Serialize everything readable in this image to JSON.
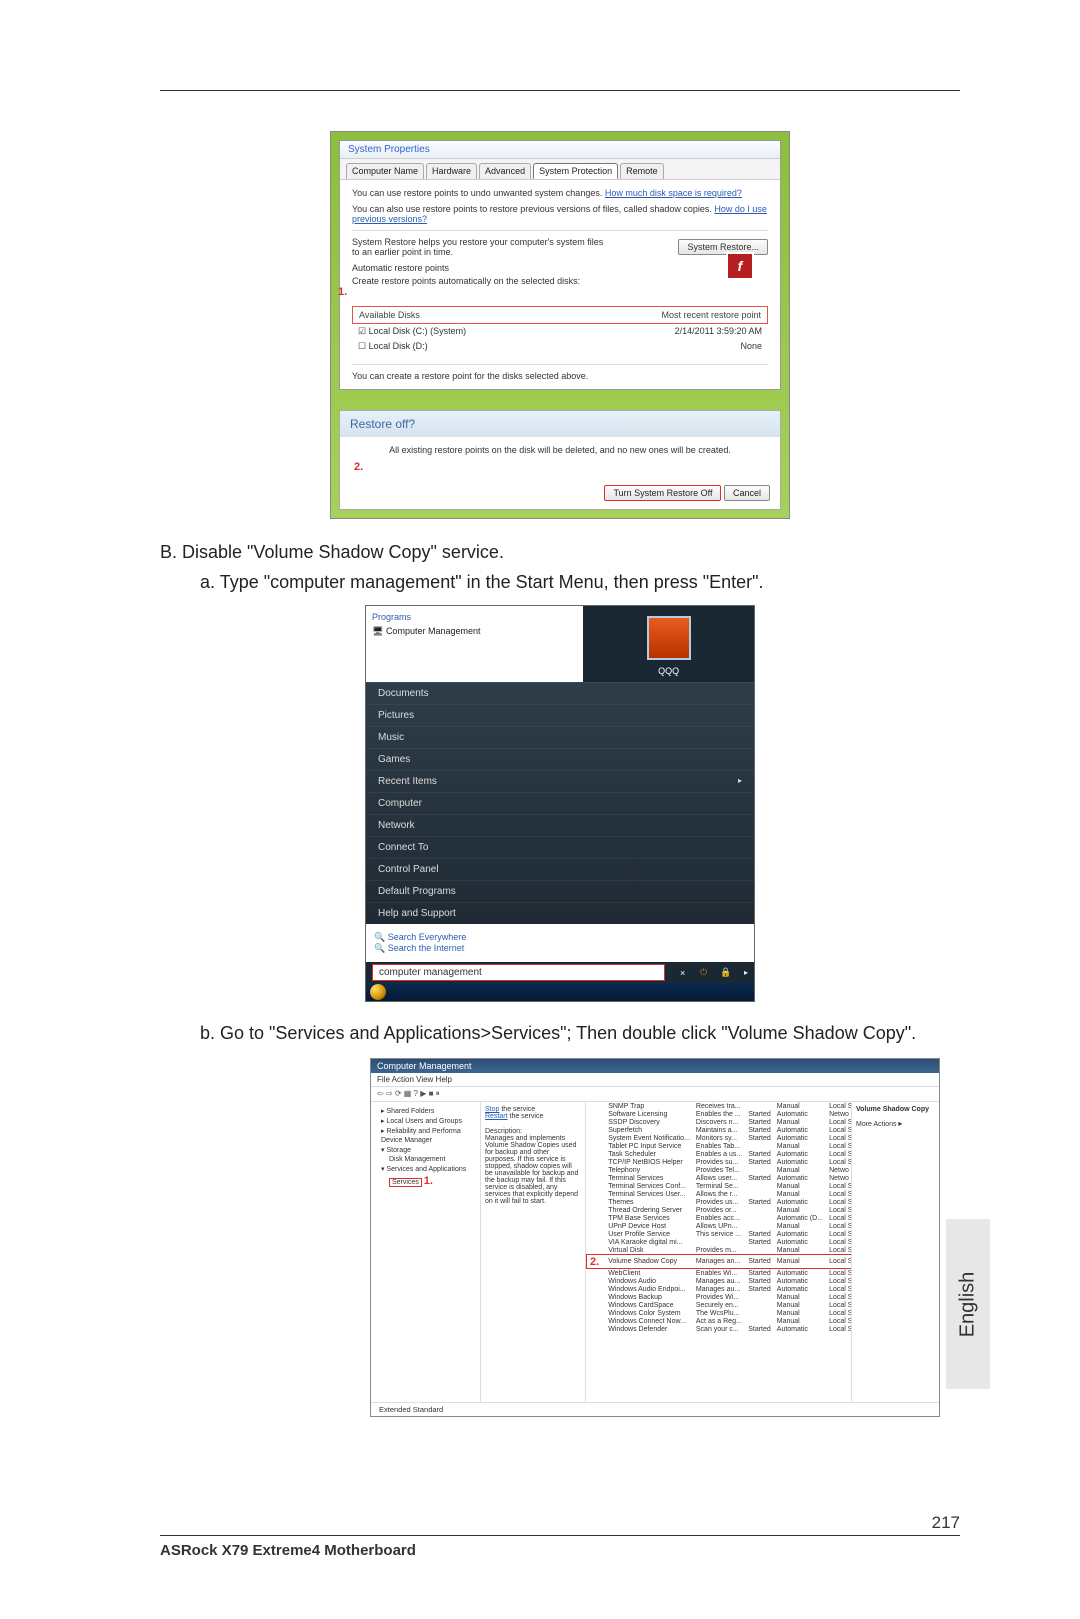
{
  "page": {
    "number": "217",
    "footer": "ASRock  X79  Extreme4  Motherboard",
    "language_tab": "English"
  },
  "instructions": {
    "b_heading": "B. Disable \"Volume Shadow Copy\" service.",
    "b_a": "a. Type \"computer management\" in the Start Menu, then press \"Enter\".",
    "b_b": "b. Go to \"Services and Applications>Services\"; Then double click \"Volume Shadow Copy\"."
  },
  "sys_props": {
    "title": "System Properties",
    "tabs": [
      "Computer Name",
      "Hardware",
      "Advanced",
      "System Protection",
      "Remote"
    ],
    "active_tab": 3,
    "line1a": "You can use restore points to undo unwanted system changes. ",
    "line1_link": "How much disk space is required?",
    "line2a": "You can also use restore points to restore previous versions of files, called shadow copies. ",
    "line2_link": "How do I use previous versions?",
    "restore_text": "System Restore helps you restore your computer's system files to an earlier point in time.",
    "restore_btn": "System Restore...",
    "auto_heading": "Automatic restore points",
    "auto_sub": "Create restore points automatically on the selected disks:",
    "col_disks": "Available Disks",
    "col_recent": "Most recent restore point",
    "disk1_name": "Local Disk (C:) (System)",
    "disk1_date": "2/14/2011 3:59:20 AM",
    "disk2_name": "Local Disk (D:)",
    "disk2_date": "None",
    "create_text": "You can create a restore point for the disks selected above.",
    "callout1": "1.",
    "desktop_icon": "install_flash..."
  },
  "confirm": {
    "title": "Restore off?",
    "body": "All existing restore points on the disk will be deleted, and no new ones will be created.",
    "callout2": "2.",
    "btn_primary": "Turn System Restore Off",
    "btn_cancel": "Cancel"
  },
  "start_menu": {
    "programs_hdr": "Programs",
    "program_item": "Computer Management",
    "user": "QQQ",
    "items": [
      "Documents",
      "Pictures",
      "Music",
      "Games",
      "Recent Items",
      "Computer",
      "Network",
      "Connect To",
      "Control Panel",
      "Default Programs",
      "Help and Support"
    ],
    "search_everywhere": "Search Everywhere",
    "search_internet": "Search the Internet",
    "search_value": "computer management",
    "close_x": "×"
  },
  "comp_mgmt": {
    "title": "Computer Management",
    "menus": "File   Action   View   Help",
    "tree": {
      "shared": "Shared Folders",
      "users": "Local Users and Groups",
      "reliability": "Reliability and Performa",
      "devmgr": "Device Manager",
      "storage": "Storage",
      "diskmgmt": "Disk Management",
      "svc_apps": "Services and Applications",
      "services": "Services",
      "callout1": "1."
    },
    "mid": {
      "stop": "Stop",
      "the_service": " the service",
      "restart": "Restart",
      "desc_hdr": "Description:",
      "desc": "Manages and implements Volume Shadow Copies used for backup and other purposes. If this service is stopped, shadow copies will be unavailable for backup and the backup may fail. If this service is disabled, any services that explicitly depend on it will fail to start."
    },
    "actions": {
      "hdr": "Volume Shadow Copy",
      "more": "More Actions"
    },
    "callout2": "2.",
    "footer_tabs": "Extended   Standard",
    "services": [
      [
        "SNMP Trap",
        "Receives tra...",
        "",
        "Manual",
        "Local S"
      ],
      [
        "Software Licensing",
        "Enables the ...",
        "Started",
        "Automatic",
        "Netwo"
      ],
      [
        "SSDP Discovery",
        "Discovers n...",
        "Started",
        "Manual",
        "Local S"
      ],
      [
        "Superfetch",
        "Maintains a...",
        "Started",
        "Automatic",
        "Local S"
      ],
      [
        "System Event Notificatio...",
        "Monitors sy...",
        "Started",
        "Automatic",
        "Local S"
      ],
      [
        "Tablet PC Input Service",
        "Enables Tab...",
        "",
        "Manual",
        "Local S"
      ],
      [
        "Task Scheduler",
        "Enables a us...",
        "Started",
        "Automatic",
        "Local S"
      ],
      [
        "TCP/IP NetBIOS Helper",
        "Provides su...",
        "Started",
        "Automatic",
        "Local S"
      ],
      [
        "Telephony",
        "Provides Tel...",
        "",
        "Manual",
        "Netwo"
      ],
      [
        "Terminal Services",
        "Allows user...",
        "Started",
        "Automatic",
        "Netwo"
      ],
      [
        "Terminal Services Conf...",
        "Terminal Se...",
        "",
        "Manual",
        "Local S"
      ],
      [
        "Terminal Services User...",
        "Allows the r...",
        "",
        "Manual",
        "Local S"
      ],
      [
        "Themes",
        "Provides us...",
        "Started",
        "Automatic",
        "Local S"
      ],
      [
        "Thread Ordering Server",
        "Provides or...",
        "",
        "Manual",
        "Local S"
      ],
      [
        "TPM Base Services",
        "Enables acc...",
        "",
        "Automatic (D...",
        "Local S"
      ],
      [
        "UPnP Device Host",
        "Allows UPn...",
        "",
        "Manual",
        "Local S"
      ],
      [
        "User Profile Service",
        "This service ...",
        "Started",
        "Automatic",
        "Local S"
      ],
      [
        "VIA Karaoke digital mi...",
        "",
        "Started",
        "Automatic",
        "Local S"
      ],
      [
        "Virtual Disk",
        "Provides m...",
        "",
        "Manual",
        "Local S"
      ],
      [
        "Volume Shadow Copy",
        "Manages an...",
        "Started",
        "Manual",
        "Local S"
      ],
      [
        "WebClient",
        "Enables Wi...",
        "Started",
        "Automatic",
        "Local S"
      ],
      [
        "Windows Audio",
        "Manages au...",
        "Started",
        "Automatic",
        "Local S"
      ],
      [
        "Windows Audio Endpoi...",
        "Manages au...",
        "Started",
        "Automatic",
        "Local S"
      ],
      [
        "Windows Backup",
        "Provides Wi...",
        "",
        "Manual",
        "Local S"
      ],
      [
        "Windows CardSpace",
        "Securely en...",
        "",
        "Manual",
        "Local S"
      ],
      [
        "Windows Color System",
        "The WcsPlu...",
        "",
        "Manual",
        "Local S"
      ],
      [
        "Windows Connect Now...",
        "Act as a Reg...",
        "",
        "Manual",
        "Local S"
      ],
      [
        "Windows Defender",
        "Scan your c...",
        "Started",
        "Automatic",
        "Local S"
      ]
    ],
    "highlight_row": 19
  }
}
